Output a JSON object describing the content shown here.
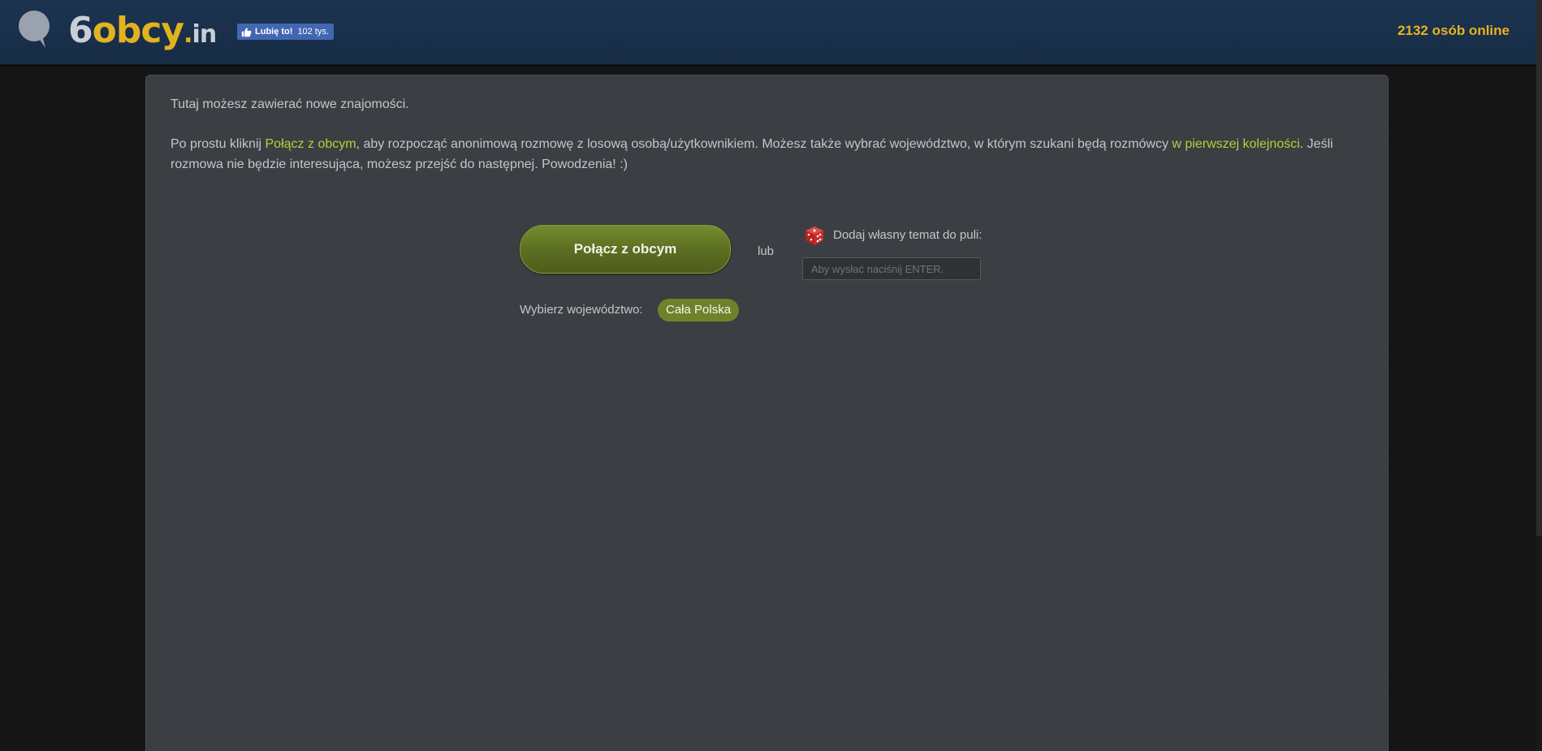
{
  "header": {
    "logo": {
      "part1": "6",
      "part2": "obcy",
      "part3": ".",
      "part4": "in"
    },
    "fb_like": {
      "label": "Lubię to!",
      "count": "102 tys."
    },
    "online_count": "2132 osób online"
  },
  "main": {
    "intro": "Tutaj możesz zawierać nowe znajomości.",
    "desc_part1": "Po prostu kliknij ",
    "desc_link1": "Połącz z obcym",
    "desc_part2": ", aby rozpocząć anonimową rozmowę z losową osobą/użytkownikiem. Możesz także wybrać województwo, w którym szukani będą rozmówcy ",
    "desc_link2": "w pierwszej kolejności",
    "desc_part3": ". Jeśli rozmowa nie będzie interesująca, możesz przejść do następnej. Powodzenia! :)",
    "connect_button": "Połącz z obcym",
    "or_label": "lub",
    "topic_label": "Dodaj własny temat do puli:",
    "topic_placeholder": "Aby wysłać naciśnij ENTER.",
    "region_label": "Wybierz województwo:",
    "region_value": "Cała Polska"
  },
  "colors": {
    "accent_green": "#6e8329",
    "highlight_text": "#b5cf3a",
    "online_yellow": "#e6b41e",
    "header_bg": "#1c3451",
    "panel_bg": "#3b3e42"
  },
  "icons": {
    "logo": "speech-bubble-icon",
    "like": "thumbs-up-icon",
    "random_topic": "dice-icon"
  }
}
